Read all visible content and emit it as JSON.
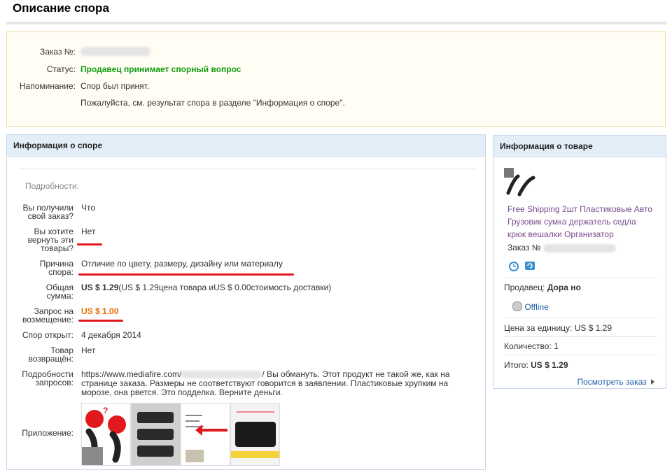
{
  "page_title": "Описание спора",
  "summary": {
    "order_label": "Заказ №:",
    "status_label": "Статус:",
    "status_value": "Продавец принимает спорный вопрос",
    "reminder_label": "Напоминание:",
    "reminder_line1": "Спор был принят.",
    "reminder_line2": "Пожалуйста, см. результат спора в разделе \"Информация о споре\"."
  },
  "dispute": {
    "header": "Информация о споре",
    "details_label": "Подробности:",
    "received_label_1": "Вы получили",
    "received_label_2": "свой заказ?",
    "received_value": "Что",
    "return_label_1": "Вы хотите",
    "return_label_2": "вернуть эти",
    "return_label_3": "товары?",
    "return_value": "Нет",
    "reason_label_1": "Причина",
    "reason_label_2": "спора:",
    "reason_value": "Отличие по цвету, размеру, дизайну или материалу",
    "total_label_1": "Общая",
    "total_label_2": "сумма:",
    "total_value_bold": "US $ 1.29",
    "total_value_rest": "(US $ 1.29цена товара иUS $ 0.00стоимость доставки)",
    "refund_label_1": "Запрос на",
    "refund_label_2": "возмещение:",
    "refund_value": "US $ 1.00",
    "opened_label": "Спор открыт:",
    "opened_value": "4 декабря 2014",
    "returned_label_1": "Товар",
    "returned_label_2": "возвращён:",
    "returned_value": "Нет",
    "request_label_1": "Подробности",
    "request_label_2": "запросов:",
    "request_url_start": "https://www.mediafire.com/",
    "request_text_1": "/ Вы обмануть. Этот продукт не такой же, как на",
    "request_text_2": "странице заказа. Размеры не соответствуют говорится в заявлении. Пластиковые хрупким на",
    "request_text_3": "морозе, она рвется. Это подделка. Верните деньги.",
    "attachment_label": "Приложение:"
  },
  "product": {
    "header": "Информация о товаре",
    "title_line1": "Free Shipping 2шт Пластиковые Авто",
    "title_line2": "Грузовик сумка держатель седла",
    "title_line3": "крюк вешалки Организатор",
    "order_label": "Заказ №",
    "seller_label": "Продавец:",
    "seller_name": "Дора но",
    "online_status": "Offline",
    "unit_price_label": "Цена за единицу:",
    "unit_price_value": "US $ 1.29",
    "quantity_label": "Количество:",
    "quantity_value": "1",
    "total_label": "Итого:",
    "total_value": "US $ 1.29",
    "view_order": "Посмотреть заказ"
  },
  "colors": {
    "status_green": "#119d11",
    "refund_orange": "#e96b00",
    "link_blue": "#1f5fa8",
    "highlight_red": "#e2191c"
  }
}
